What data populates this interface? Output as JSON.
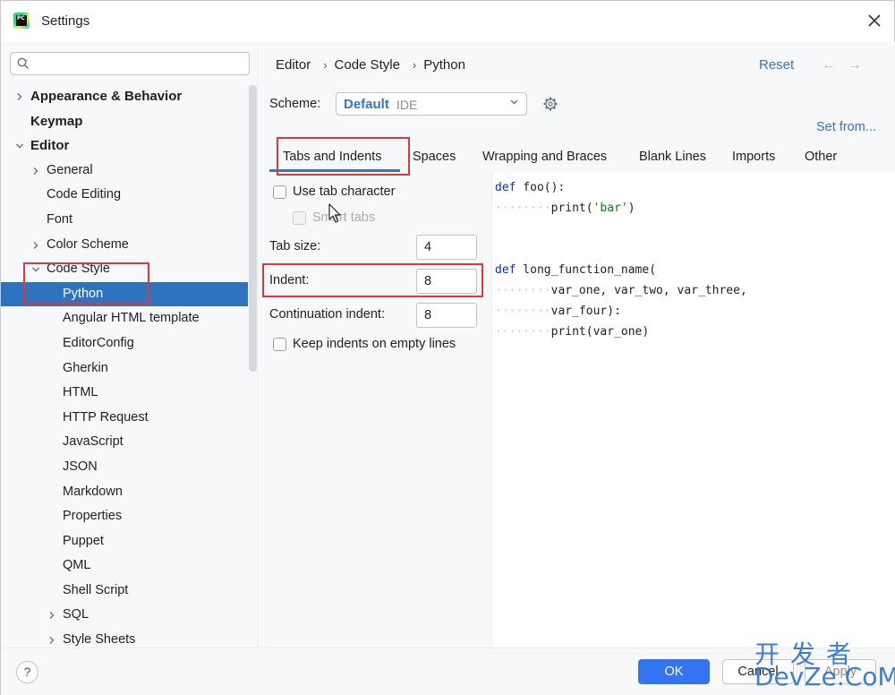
{
  "window": {
    "title": "Settings",
    "app_icon_text": "PC"
  },
  "sidebar": {
    "search_placeholder": "",
    "items": [
      {
        "label": "Appearance & Behavior",
        "level": 0,
        "bold": true,
        "expander": "collapsed"
      },
      {
        "label": "Keymap",
        "level": 0,
        "bold": true,
        "expander": "none"
      },
      {
        "label": "Editor",
        "level": 0,
        "bold": true,
        "expander": "expanded"
      },
      {
        "label": "General",
        "level": 1,
        "bold": false,
        "expander": "collapsed"
      },
      {
        "label": "Code Editing",
        "level": 1,
        "bold": false,
        "expander": "none"
      },
      {
        "label": "Font",
        "level": 1,
        "bold": false,
        "expander": "none"
      },
      {
        "label": "Color Scheme",
        "level": 1,
        "bold": false,
        "expander": "collapsed"
      },
      {
        "label": "Code Style",
        "level": 1,
        "bold": false,
        "expander": "expanded"
      },
      {
        "label": "Python",
        "level": 2,
        "bold": false,
        "expander": "none",
        "selected": true
      },
      {
        "label": "Angular HTML template",
        "level": 2,
        "bold": false,
        "expander": "none"
      },
      {
        "label": "EditorConfig",
        "level": 2,
        "bold": false,
        "expander": "none"
      },
      {
        "label": "Gherkin",
        "level": 2,
        "bold": false,
        "expander": "none"
      },
      {
        "label": "HTML",
        "level": 2,
        "bold": false,
        "expander": "none"
      },
      {
        "label": "HTTP Request",
        "level": 2,
        "bold": false,
        "expander": "none"
      },
      {
        "label": "JavaScript",
        "level": 2,
        "bold": false,
        "expander": "none"
      },
      {
        "label": "JSON",
        "level": 2,
        "bold": false,
        "expander": "none"
      },
      {
        "label": "Markdown",
        "level": 2,
        "bold": false,
        "expander": "none"
      },
      {
        "label": "Properties",
        "level": 2,
        "bold": false,
        "expander": "none"
      },
      {
        "label": "Puppet",
        "level": 2,
        "bold": false,
        "expander": "none"
      },
      {
        "label": "QML",
        "level": 2,
        "bold": false,
        "expander": "none"
      },
      {
        "label": "Shell Script",
        "level": 2,
        "bold": false,
        "expander": "none"
      },
      {
        "label": "SQL",
        "level": 2,
        "bold": false,
        "expander": "collapsed"
      },
      {
        "label": "Style Sheets",
        "level": 2,
        "bold": false,
        "expander": "collapsed"
      }
    ]
  },
  "header": {
    "breadcrumb": [
      "Editor",
      "Code Style",
      "Python"
    ],
    "breadcrumb_sep": "›",
    "reset": "Reset",
    "back_arrow": "←",
    "forward_arrow": "→"
  },
  "scheme": {
    "label": "Scheme:",
    "value": "Default",
    "sub": "IDE",
    "set_from": "Set from..."
  },
  "tabs": [
    {
      "label": "Tabs and Indents",
      "active": true
    },
    {
      "label": "Spaces"
    },
    {
      "label": "Wrapping and Braces"
    },
    {
      "label": "Blank Lines"
    },
    {
      "label": "Imports"
    },
    {
      "label": "Other"
    }
  ],
  "options": {
    "use_tab_character": {
      "label": "Use tab character",
      "checked": false
    },
    "smart_tabs": {
      "label": "Smart tabs",
      "checked": false,
      "disabled": true
    },
    "tab_size": {
      "label": "Tab size:",
      "value": "4"
    },
    "indent": {
      "label": "Indent:",
      "value": "8"
    },
    "continuation_indent": {
      "label": "Continuation indent:",
      "value": "8"
    },
    "keep_indents": {
      "label": "Keep indents on empty lines",
      "checked": false
    }
  },
  "preview": {
    "lines": [
      {
        "kw": "def",
        "rest": " foo():"
      },
      {
        "indent": "········",
        "text_pre": "print(",
        "str": "'bar'",
        "text_post": ")"
      },
      {
        "kw": "def",
        "rest": " long_function_name("
      },
      {
        "indent": "········",
        "text": "var_one, var_two, var_three,"
      },
      {
        "indent": "········",
        "text": "var_four):"
      },
      {
        "indent": "········",
        "text": "print(var_one)"
      }
    ]
  },
  "footer": {
    "help": "?",
    "ok": "OK",
    "cancel": "Cancel",
    "apply": "Apply"
  },
  "watermark": {
    "top": "开发者",
    "bottom": "DevZe.CoM"
  },
  "colors": {
    "accent": "#3574c4",
    "selection": "#2e73c0",
    "highlight_box": "#e0363e",
    "ok_button": "#3574f0"
  }
}
